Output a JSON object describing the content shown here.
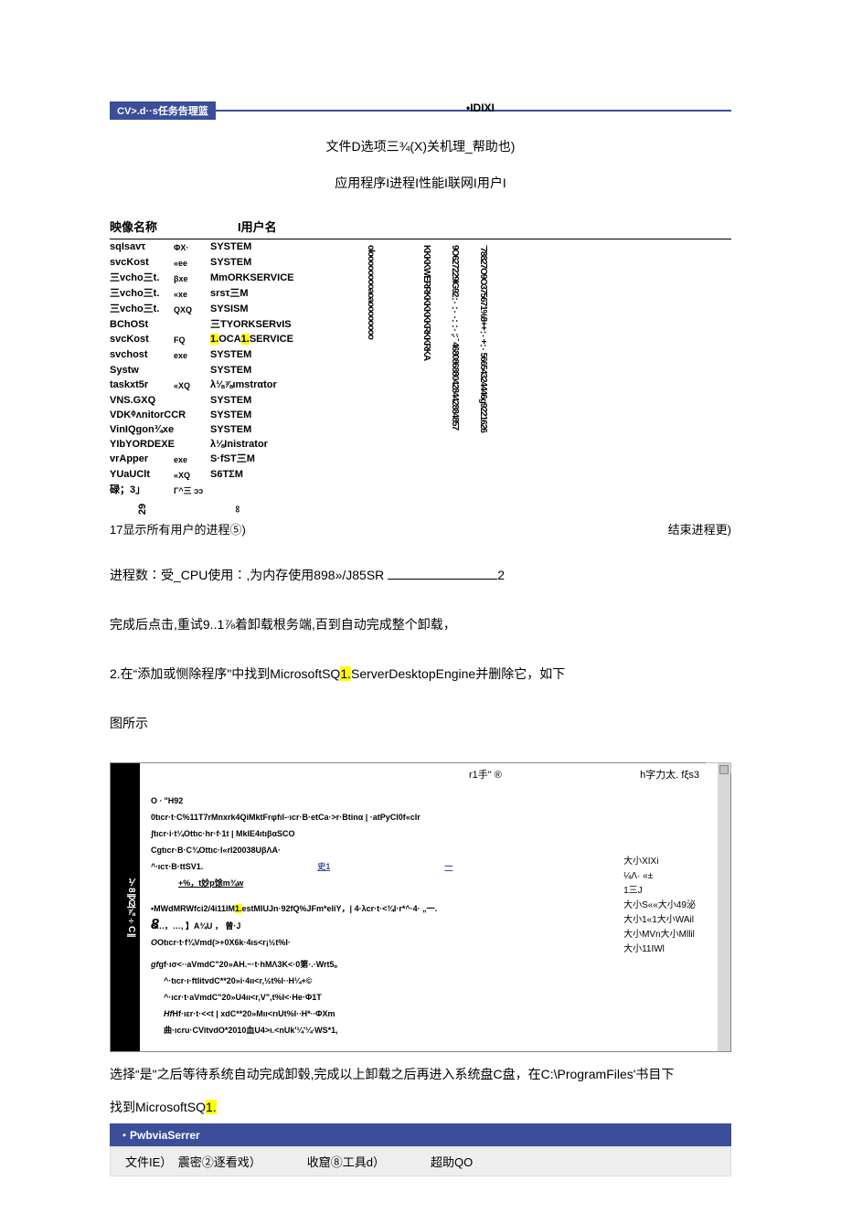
{
  "header": {
    "titlePill": "CV>.d··s任务告理篮",
    "idixi": "•IDIXI",
    "menuLine": "文件D选项三¾(X)关机理_帮助也)",
    "tabsLine": "应用程序I进程I性能I联网I用户I"
  },
  "processTable": {
    "headers": {
      "name": "映像名称",
      "user": "I用户名"
    },
    "rows": [
      {
        "name": "sqIsavτ",
        "ext": "ΦX·",
        "user": "SYSTEM"
      },
      {
        "name": "svcKost",
        "ext": "«ee",
        "user": "SYSTEM"
      },
      {
        "name": "三vcho三t.",
        "ext": "βxe",
        "user": "MmORKSERVICE"
      },
      {
        "name": "三vcho三t.",
        "ext": "«xe",
        "user": "srsτ三M"
      },
      {
        "name": "三vcho三t.",
        "ext": "QXQ",
        "user": "SYSISM"
      },
      {
        "name": "BChOSt",
        "ext": "",
        "user": "三TYORKSERvIS"
      },
      {
        "name": "svcKost",
        "ext": "FQ",
        "user": "1.OCA1.SERVICE",
        "hl": true
      },
      {
        "name": "svchost",
        "ext": "exe",
        "user": "SYSTEM"
      },
      {
        "name": "Systw",
        "ext": "",
        "user": "SYSTEM"
      },
      {
        "name": "taskxt5r",
        "ext": "«XQ",
        "user": "λ⅛⅞ιmstrαtor"
      },
      {
        "name": "VNS.GXQ",
        "ext": "",
        "user": "SYSTEM"
      },
      {
        "name": "VDKᶲʌnitorCCR",
        "ext": "",
        "user": "SYSTEM"
      },
      {
        "name": "VinIQgon¾xe",
        "ext": "",
        "user": "SYSTEM"
      },
      {
        "name": "YIbYORDEXE",
        "ext": "",
        "user": "λ⅛Inistrator"
      },
      {
        "name": "vrApper",
        "ext": "exe",
        "user": "S·fST三M"
      },
      {
        "name": "YUaUClt",
        "ext": "«XQ",
        "user": "S6TΣM"
      },
      {
        "name": "碌；3」",
        "ext": "Γ^三 ɔɔ",
        "user": ""
      }
    ],
    "vCol1": "olooooooooaoaoooooooo",
    "vCol2": "KKKKWERRKKKKKKRKKRKA",
    "vCol3": "9O627229IG92∵∵∴∵;∶ ˉ 468086880428442884857",
    "vCol4": "ˉ78827O9O375671%8++∵+∵56654324446g9221626",
    "num29": "29",
    "numInf": "∞"
  },
  "underTable": {
    "left": "17显示所有用户的进程⑤)",
    "right": "结束进程更)"
  },
  "paragraphs": {
    "p1a": "进程数∶受_CPU使用∶,为内存使用898»/J85SR ",
    "p1b": "2",
    "p2": "完成后点击,重试9..1⅞着卸载根务端,百到自动完成整个卸载，",
    "p3a": "2.在“添加或恻除程序\"中找到MicrosoftSQ",
    "p3hl": "1.",
    "p3b": "ServerDesktopEngine并删除它，如下",
    "p4": "图所示"
  },
  "addRemove": {
    "winCtrl": "ˍ □ ×",
    "navText": "⅟8 ||X2|⅞÷C ||",
    "topMid": "r1手\" ®",
    "topRight": "h字力太. fξs3",
    "lines": [
      "O ∙ \"H92",
      "0tιcr·t·C%11T7rMnxrk4QiMktFrφfıI-∙ıcr·B·etCa·>r·Btinα | ·atPyCl0f«clr",
      "",
      "ʃtıcr·i·t¼Ottιc·hr·f·1t | MkIE4ıtıβαSCO",
      "Cgtιcr·B·C¾Ottιc·I«rI20038UβΛA·"
    ],
    "linkRowA": "^∙ıcτ·B·ttSV1.",
    "linkRowB": "史1",
    "linkRowC": "一",
    "sub1": "+%，t妙p馀m¾w",
    "long1a": "•MWdMRWfci2/4i11IM",
    "long1hl": "1.",
    "long1b": "estMIUJn·92fQ%JFm*eliY，| 4·λcr·t·<¾I·r*^·4·        „一.",
    "l8": "8…，…,                        】A¾U ， 曾·J",
    "lineO": "Otıcr·t·f¾Vmd(>+0X6k·4ıs<r¡½t%I·",
    "gf": "gf·ıσ<·∙aVmdC\"20»AH.~·t·hMΛ3Κ<·0第·.·Wrt5。",
    "tail1": "^·tıcr·ı·ftlitvdC**20»i·4ıı<r,½t%I·∙H¼+©",
    "tail2": "^·ıcr·t·aVmdC\"20»U4ıı<r,V\",t%I<·He·Φ1T",
    "tailHf": "Hf·ıεr·t·<<t | xdC**20»Mıı<rıUt%I·∙H*·∙ΦXm",
    "tailQu": "曲·ıcru·CVitvdO*2010血U4>ı.<nUk'¼'¼∙WS*1,",
    "sizeCol": [
      "大小XIXi",
      "¼Λ·        «±",
      "            1三J",
      "大小S««大小49泌",
      "大小1«1大小WAil",
      "大小MVn大小Mllil",
      "大小11IWl"
    ]
  },
  "afterShot": {
    "para": "选择“是\"之后等待系统自动完成卸毂,完成以上卸载之后再进入系统盘C盘，在C:\\ProgramFiles'书目下",
    "para2a": "找到MicrosoftSQ",
    "para2hl": "1."
  },
  "blueBar": "・PwbviaSerrer",
  "fileMenu": {
    "items": [
      "文件IE）　震密②逐看戏）",
      "收窟⑧工具d）",
      "超助QO"
    ]
  }
}
